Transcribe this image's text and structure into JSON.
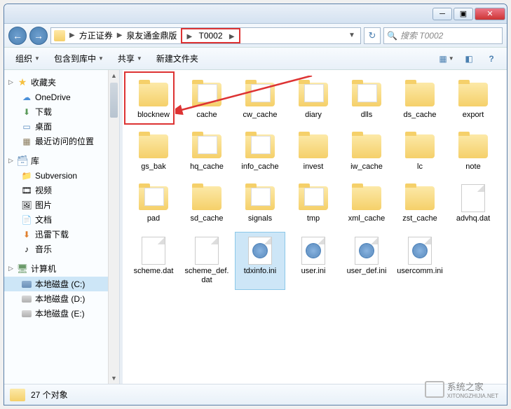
{
  "titlebar": {
    "min": "─",
    "max": "▣",
    "close": "✕"
  },
  "nav": {
    "back": "←",
    "fwd": "→"
  },
  "breadcrumb": {
    "seg1": "方正证券",
    "seg2": "泉友通金鼎版",
    "seg3": "T0002"
  },
  "search": {
    "placeholder": "搜索 T0002"
  },
  "toolbar": {
    "organize": "组织",
    "include": "包含到库中",
    "share": "共享",
    "newfolder": "新建文件夹"
  },
  "sidebar": {
    "favorites": "收藏夹",
    "fav_items": {
      "onedrive": "OneDrive",
      "downloads": "下载",
      "desktop": "桌面",
      "recent": "最近访问的位置"
    },
    "libraries": "库",
    "lib_items": {
      "subversion": "Subversion",
      "videos": "视频",
      "pictures": "图片",
      "documents": "文档",
      "xunlei": "迅雷下载",
      "music": "音乐"
    },
    "computer": "计算机",
    "drives": {
      "c": "本地磁盘 (C:)",
      "d": "本地磁盘 (D:)",
      "e": "本地磁盘 (E:)"
    }
  },
  "items": [
    {
      "name": "blocknew",
      "type": "folder"
    },
    {
      "name": "cache",
      "type": "folder-full"
    },
    {
      "name": "cw_cache",
      "type": "folder-full"
    },
    {
      "name": "diary",
      "type": "folder-full"
    },
    {
      "name": "dlls",
      "type": "folder-full"
    },
    {
      "name": "ds_cache",
      "type": "folder"
    },
    {
      "name": "export",
      "type": "folder"
    },
    {
      "name": "gs_bak",
      "type": "folder"
    },
    {
      "name": "hq_cache",
      "type": "folder-full"
    },
    {
      "name": "info_cache",
      "type": "folder-full"
    },
    {
      "name": "invest",
      "type": "folder"
    },
    {
      "name": "iw_cache",
      "type": "folder"
    },
    {
      "name": "lc",
      "type": "folder"
    },
    {
      "name": "note",
      "type": "folder"
    },
    {
      "name": "pad",
      "type": "folder-full"
    },
    {
      "name": "sd_cache",
      "type": "folder"
    },
    {
      "name": "signals",
      "type": "folder-full"
    },
    {
      "name": "tmp",
      "type": "folder-full"
    },
    {
      "name": "xml_cache",
      "type": "folder"
    },
    {
      "name": "zst_cache",
      "type": "folder"
    },
    {
      "name": "advhq.dat",
      "type": "file"
    },
    {
      "name": "scheme.dat",
      "type": "file"
    },
    {
      "name": "scheme_def.dat",
      "type": "file"
    },
    {
      "name": "tdxinfo.ini",
      "type": "ini",
      "selected": true
    },
    {
      "name": "user.ini",
      "type": "ini"
    },
    {
      "name": "user_def.ini",
      "type": "ini"
    },
    {
      "name": "usercomm.ini",
      "type": "ini"
    }
  ],
  "status": {
    "count": "27 个对象"
  },
  "watermark": {
    "line1": "系统之家",
    "line2": "XITONGZHIJIA.NET"
  }
}
